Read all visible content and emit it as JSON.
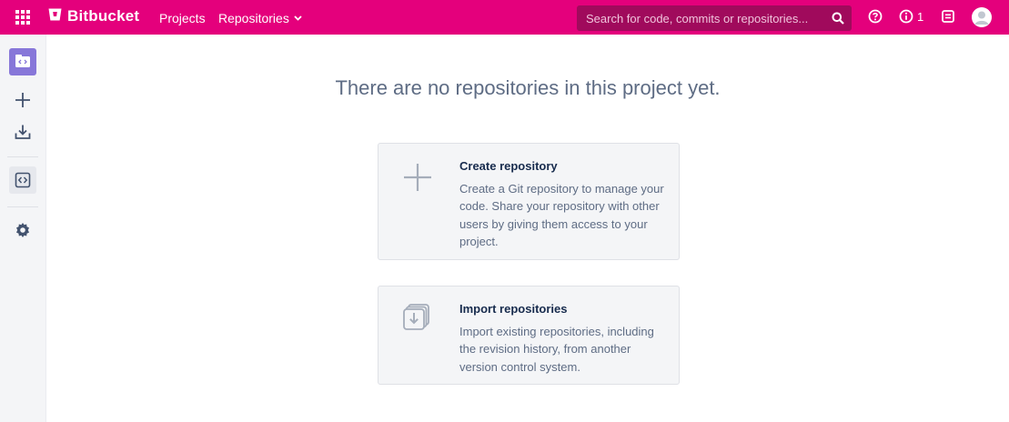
{
  "header": {
    "product_name": "Bitbucket",
    "nav": {
      "projects": "Projects",
      "repositories": "Repositories"
    },
    "search": {
      "placeholder": "Search for code, commits or repositories..."
    },
    "notification_count": "1"
  },
  "sidebar": {
    "items": [
      "project-avatar-icon",
      "plus-icon",
      "download-icon",
      "code-icon",
      "gear-icon"
    ]
  },
  "main": {
    "empty_message": "There are no repositories in this project yet.",
    "cards": [
      {
        "title": "Create repository",
        "description": "Create a Git repository to manage your code. Share your repository with other users by giving them access to your project."
      },
      {
        "title": "Import repositories",
        "description": "Import existing repositories, including the revision history, from another version control system."
      }
    ]
  },
  "colors": {
    "brand": "#e4007c",
    "search_bg": "#a00a5c",
    "sidebar_bg": "#f4f5f7",
    "card_bg": "#f4f5f7",
    "muted_text": "#5e6c84"
  }
}
